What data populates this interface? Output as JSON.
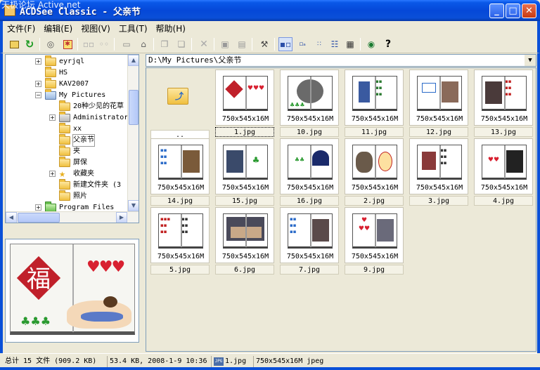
{
  "window": {
    "title": "ACDSee Classic - 父亲节",
    "watermark": "天极论坛 Active.net"
  },
  "menu": [
    "文件(F)",
    "编辑(E)",
    "视图(V)",
    "工具(T)",
    "帮助(H)"
  ],
  "tree": {
    "items": [
      {
        "label": "eyrjql",
        "depth": 2,
        "expand": "+"
      },
      {
        "label": "HS",
        "depth": 2,
        "expand": ""
      },
      {
        "label": "KAV2007",
        "depth": 2,
        "expand": "+"
      },
      {
        "label": "My Pictures",
        "depth": 2,
        "expand": "−"
      },
      {
        "label": "20种少见的花草",
        "depth": 3,
        "expand": ""
      },
      {
        "label": "Administrator",
        "depth": 3,
        "expand": "+"
      },
      {
        "label": "xx",
        "depth": 3,
        "expand": ""
      },
      {
        "label": "父亲节",
        "depth": 3,
        "expand": ""
      },
      {
        "label": "夹",
        "depth": 3,
        "expand": ""
      },
      {
        "label": "屏保",
        "depth": 3,
        "expand": ""
      },
      {
        "label": "收藏夹",
        "depth": 3,
        "expand": "+"
      },
      {
        "label": "新建文件夹 (3",
        "depth": 3,
        "expand": ""
      },
      {
        "label": "照片",
        "depth": 3,
        "expand": ""
      },
      {
        "label": "Program Files",
        "depth": 1,
        "expand": "+"
      }
    ]
  },
  "preview": {
    "char": "福",
    "hearts": [
      "♥",
      "♥",
      "♥"
    ],
    "clubs": [
      "♣",
      "♣",
      "♣"
    ]
  },
  "address": {
    "path": "D:\\My Pictures\\父亲节"
  },
  "thumbnails": [
    {
      "name": "..",
      "size": ""
    },
    {
      "name": "1.jpg",
      "size": "750x545x16M"
    },
    {
      "name": "10.jpg",
      "size": "750x545x16M"
    },
    {
      "name": "11.jpg",
      "size": "750x545x16M"
    },
    {
      "name": "12.jpg",
      "size": "750x545x16M"
    },
    {
      "name": "13.jpg",
      "size": "750x545x16M"
    },
    {
      "name": "14.jpg",
      "size": "750x545x16M"
    },
    {
      "name": "15.jpg",
      "size": "750x545x16M"
    },
    {
      "name": "16.jpg",
      "size": "750x545x16M"
    },
    {
      "name": "2.jpg",
      "size": "750x545x16M"
    },
    {
      "name": "3.jpg",
      "size": "750x545x16M"
    },
    {
      "name": "4.jpg",
      "size": "750x545x16M"
    },
    {
      "name": "5.jpg",
      "size": "750x545x16M"
    },
    {
      "name": "6.jpg",
      "size": "750x545x16M"
    },
    {
      "name": "7.jpg",
      "size": "750x545x16M"
    },
    {
      "name": "9.jpg",
      "size": "750x545x16M"
    }
  ],
  "status": {
    "total": "总计 15 文件 (909.2 KB)",
    "info": "53.4 KB, 2008-1-9 10:36",
    "file_badge": "JPG",
    "file": "1.jpg",
    "dims": "750x545x16M jpeg"
  },
  "colors": {
    "titlebar": "#0548d8",
    "face": "#ece9d8",
    "accent_red": "#c0202a"
  }
}
